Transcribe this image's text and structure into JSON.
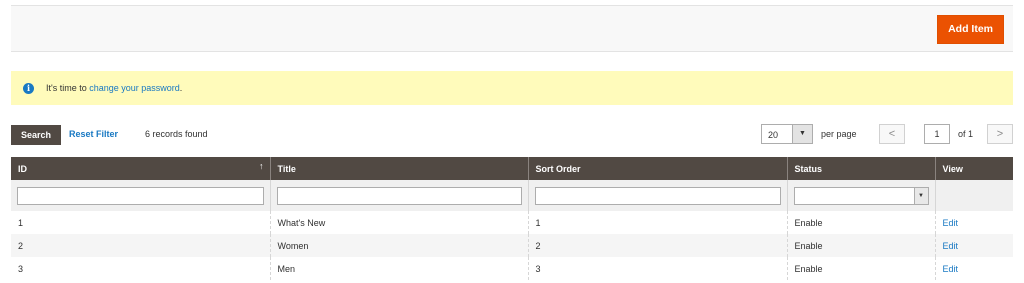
{
  "header": {
    "add_item_label": "Add Item"
  },
  "notice": {
    "prefix": "It's time to ",
    "link_text": "change your password",
    "suffix": "."
  },
  "toolbar": {
    "search_label": "Search",
    "reset_label": "Reset Filter",
    "records_text": "6 records found",
    "per_page_value": "20",
    "per_page_label": "per page",
    "page_value": "1",
    "page_of": "of 1"
  },
  "grid": {
    "columns": [
      "ID",
      "Title",
      "Sort Order",
      "Status",
      "View"
    ],
    "rows": [
      {
        "id": "1",
        "title": "What's New",
        "sort_order": "1",
        "status": "Enable",
        "view": "Edit"
      },
      {
        "id": "2",
        "title": "Women",
        "sort_order": "2",
        "status": "Enable",
        "view": "Edit"
      },
      {
        "id": "3",
        "title": "Men",
        "sort_order": "3",
        "status": "Enable",
        "view": "Edit"
      }
    ]
  },
  "icons": {
    "info": "info-icon",
    "sort": "sort-up-arrow-icon",
    "dropdown": "chevron-down-icon",
    "prev": "chevron-left-icon",
    "next": "chevron-right-icon"
  },
  "colors": {
    "accent": "#eb5202",
    "header_bg": "#514943",
    "link": "#1979c3",
    "notice_bg": "#fffbbb"
  }
}
